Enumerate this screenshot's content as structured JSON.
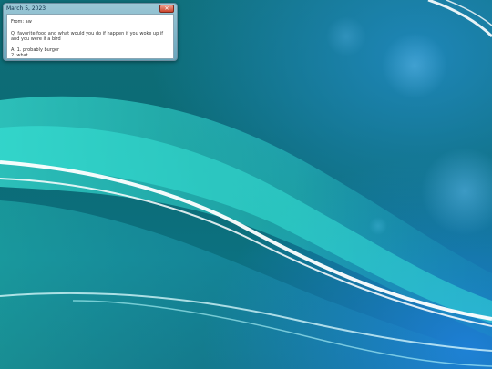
{
  "window": {
    "title": "March 5, 2023",
    "close_symbol": "✕",
    "body": {
      "from": "From: aw",
      "question": "Q: favorite food and what would you do if happen if you woke up if and you were if a bird",
      "answer_line1": "A: 1. probably burger",
      "answer_line2": "2. what"
    }
  },
  "desktop": {
    "wallpaper": "teal-blue abstract curves",
    "colors": {
      "base": "#0c6e78",
      "accent_cyan": "#3ef0e0",
      "accent_blue": "#1f84d6"
    }
  }
}
